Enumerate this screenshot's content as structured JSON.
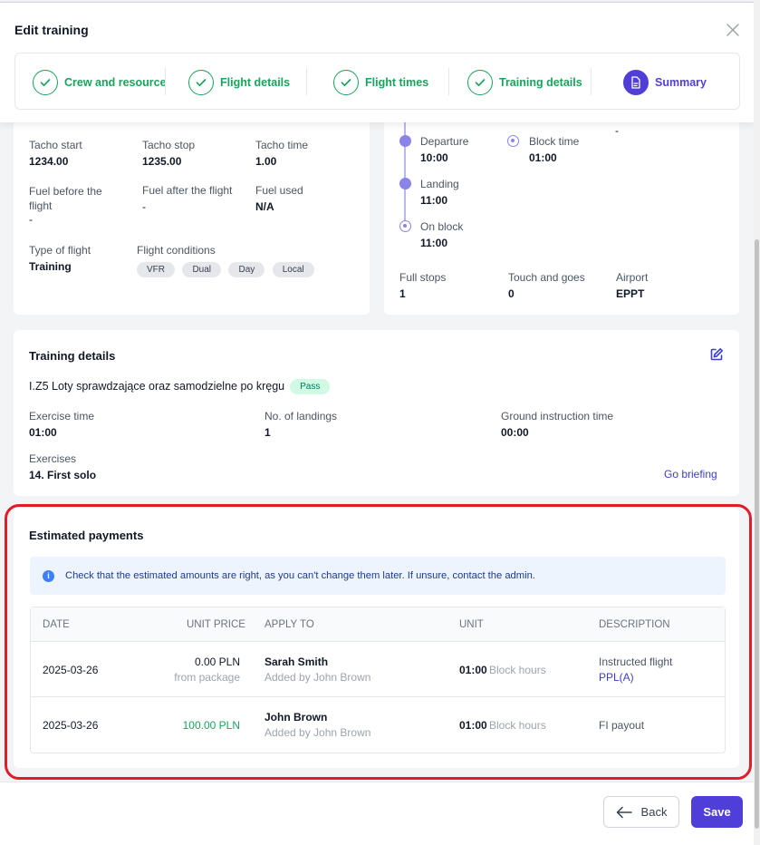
{
  "modal": {
    "title": "Edit training"
  },
  "steps": [
    {
      "label": "Crew and resource",
      "state": "done"
    },
    {
      "label": "Flight details",
      "state": "done"
    },
    {
      "label": "Flight times",
      "state": "done"
    },
    {
      "label": "Training details",
      "state": "done"
    },
    {
      "label": "Summary",
      "state": "active"
    }
  ],
  "flight_info": {
    "tacho_start": {
      "label": "Tacho start",
      "value": "1234.00"
    },
    "tacho_stop": {
      "label": "Tacho stop",
      "value": "1235.00"
    },
    "tacho_time": {
      "label": "Tacho time",
      "value": "1.00"
    },
    "fuel_before": {
      "label": "Fuel before the flight",
      "value": "-"
    },
    "fuel_after": {
      "label": "Fuel after the flight",
      "value": "-"
    },
    "fuel_used": {
      "label": "Fuel used",
      "value": "N/A"
    },
    "type_of_flight": {
      "label": "Type of flight",
      "value": "Training"
    },
    "flight_conditions": {
      "label": "Flight conditions",
      "tags": [
        "VFR",
        "Dual",
        "Day",
        "Local"
      ]
    }
  },
  "flight_times": {
    "top_right_value": "-",
    "departure": {
      "label": "Departure",
      "value": "10:00"
    },
    "block_time": {
      "label": "Block time",
      "value": "01:00"
    },
    "landing": {
      "label": "Landing",
      "value": "11:00"
    },
    "on_block": {
      "label": "On block",
      "value": "11:00"
    },
    "full_stops": {
      "label": "Full stops",
      "value": "1"
    },
    "touch_and_goes": {
      "label": "Touch and goes",
      "value": "0"
    },
    "airport": {
      "label": "Airport",
      "value": "EPPT"
    }
  },
  "training_details": {
    "title": "Training details",
    "lesson": "I.Z5 Loty sprawdzające oraz samodzielne po kręgu",
    "result_badge": "Pass",
    "exercise_time": {
      "label": "Exercise time",
      "value": "01:00"
    },
    "landings": {
      "label": "No. of landings",
      "value": "1"
    },
    "ground_time": {
      "label": "Ground instruction time",
      "value": "00:00"
    },
    "exercises": {
      "label": "Exercises",
      "value": "14. First solo"
    },
    "briefing_link": "Go briefing"
  },
  "payments": {
    "title": "Estimated payments",
    "info": "Check that the estimated amounts are right, as you can't change them later. If unsure, contact the admin.",
    "columns": [
      "DATE",
      "UNIT PRICE",
      "APPLY TO",
      "UNIT",
      "DESCRIPTION"
    ],
    "rows": [
      {
        "date": "2025-03-26",
        "price": "0.00 PLN",
        "price_note": "from package",
        "person": "Sarah Smith",
        "added_by": "Added by John Brown",
        "unit_value": "01:00",
        "unit_label": "Block hours",
        "description": "Instructed flight",
        "description_link": "PPL(A)"
      },
      {
        "date": "2025-03-26",
        "price": "100.00 PLN",
        "price_note": "",
        "person": "John Brown",
        "added_by": "Added by John Brown",
        "unit_value": "01:00",
        "unit_label": "Block hours",
        "description": "FI payout",
        "description_link": ""
      }
    ]
  },
  "footer": {
    "back_label": "Back",
    "save_label": "Save"
  },
  "colors": {
    "accent": "#4f3fd8",
    "success": "#1aa35b",
    "highlight": "#e11d2a"
  }
}
